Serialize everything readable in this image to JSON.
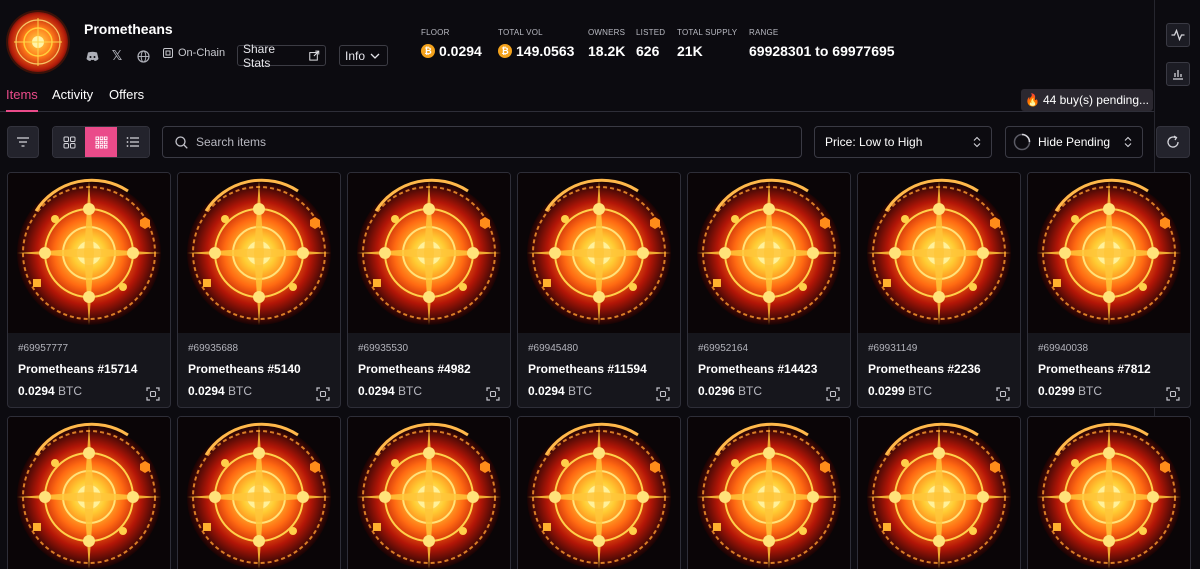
{
  "collection": {
    "name": "Prometheans",
    "onchain_label": "On-Chain",
    "share_label": "Share Stats",
    "info_label": "Info"
  },
  "stats": [
    {
      "label": "FLOOR",
      "value": "0.0294",
      "coin": true
    },
    {
      "label": "TOTAL VOL",
      "value": "149.0563",
      "coin": true
    },
    {
      "label": "OWNERS",
      "value": "18.2K",
      "coin": false
    },
    {
      "label": "LISTED",
      "value": "626",
      "coin": false
    },
    {
      "label": "TOTAL SUPPLY",
      "value": "21K",
      "coin": false
    },
    {
      "label": "RANGE",
      "value": "69928301 to 69977695",
      "coin": false
    }
  ],
  "tabs": [
    {
      "label": "Items",
      "active": true
    },
    {
      "label": "Activity",
      "active": false
    },
    {
      "label": "Offers",
      "active": false
    }
  ],
  "pending": "44 buy(s) pending...",
  "toolbar": {
    "search_placeholder": "Search items",
    "sort_value": "Price: Low to High",
    "hide_pending_label": "Hide Pending"
  },
  "icons": {
    "discord": "discord-icon",
    "x": "x-icon",
    "globe": "globe-icon",
    "bitcoin": "bitcoin-icon"
  },
  "colors": {
    "accent": "#ea4b8a",
    "btc": "#f3a21c",
    "background": "#0c0b10"
  },
  "items": [
    {
      "inscription": "#69957777",
      "name": "Prometheans #15714",
      "price": "0.0294",
      "unit": "BTC"
    },
    {
      "inscription": "#69935688",
      "name": "Prometheans #5140",
      "price": "0.0294",
      "unit": "BTC"
    },
    {
      "inscription": "#69935530",
      "name": "Prometheans #4982",
      "price": "0.0294",
      "unit": "BTC"
    },
    {
      "inscription": "#69945480",
      "name": "Prometheans #11594",
      "price": "0.0294",
      "unit": "BTC"
    },
    {
      "inscription": "#69952164",
      "name": "Prometheans #14423",
      "price": "0.0296",
      "unit": "BTC"
    },
    {
      "inscription": "#69931149",
      "name": "Prometheans #2236",
      "price": "0.0299",
      "unit": "BTC"
    },
    {
      "inscription": "#69940038",
      "name": "Prometheans #7812",
      "price": "0.0299",
      "unit": "BTC"
    }
  ]
}
